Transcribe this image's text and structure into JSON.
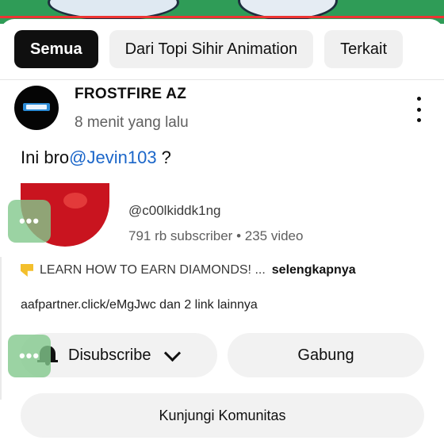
{
  "chips": [
    {
      "label": "Semua",
      "active": true
    },
    {
      "label": "Dari Topi Sihir Animation",
      "active": false
    },
    {
      "label": "Terkait",
      "active": false
    }
  ],
  "comment": {
    "author": "FROSTFIRE AZ",
    "time": "8 menit yang lalu",
    "text_before": "Ini bro",
    "mention": "@Jevin103",
    "text_after": " ?"
  },
  "channel": {
    "handle": "@c00lkiddk1ng",
    "stats": "791 rb subscriber • 235 video",
    "description": "LEARN HOW TO EARN DIAMONDS! ...",
    "more": "selengkapnya",
    "links": "aafpartner.click/eMgJwc dan 2 link lainnya"
  },
  "buttons": {
    "subscribe": "Disubscribe",
    "join": "Gabung",
    "community": "Kunjungi Komunitas"
  },
  "overlay_label": "•••",
  "icons": [
    "bell-icon",
    "chevron-down-icon",
    "more-vert-icon",
    "pin-icon"
  ],
  "colors": {
    "mention": "#1b66c9",
    "active_chip": "#0f0f0f",
    "overlay": "#82c88c"
  }
}
